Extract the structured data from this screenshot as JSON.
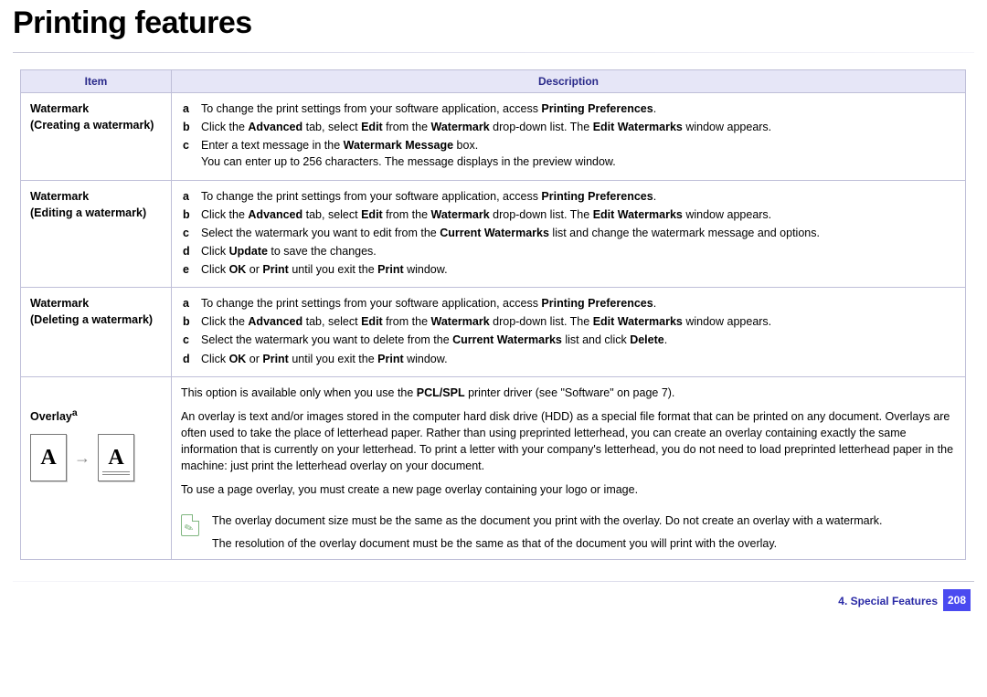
{
  "title": "Printing features",
  "table": {
    "headers": {
      "item": "Item",
      "description": "Description"
    },
    "rows": {
      "r1": {
        "item_head": "Watermark",
        "item_sub": "(Creating a watermark)",
        "a": {
          "pre": "To change the print settings from your software application, access ",
          "b1": "Printing Preferences",
          "post": "."
        },
        "b": {
          "t1": "Click the ",
          "b1": "Advanced",
          "t2": " tab, select ",
          "b2": "Edit",
          "t3": " from the ",
          "b3": "Watermark",
          "t4": " drop-down list. The ",
          "b4": "Edit Watermarks",
          "t5": " window appears."
        },
        "c": {
          "t1": "Enter a text message in the ",
          "b1": "Watermark Message",
          "t2": " box."
        },
        "c_note": "You can enter up to 256 characters. The message displays in the preview window."
      },
      "r2": {
        "item_head": "Watermark",
        "item_sub": "(Editing a watermark)",
        "a": {
          "pre": "To change the print settings from your software application, access ",
          "b1": "Printing Preferences",
          "post": "."
        },
        "b": {
          "t1": "Click the ",
          "b1": "Advanced",
          "t2": " tab, select ",
          "b2": "Edit",
          "t3": " from the ",
          "b3": "Watermark",
          "t4": " drop-down list. The ",
          "b4": "Edit Watermarks",
          "t5": " window appears."
        },
        "c": {
          "t1": "Select the watermark you want to edit from the ",
          "b1": "Current Watermarks",
          "t2": " list and change the watermark message and options."
        },
        "d": {
          "t1": "Click ",
          "b1": "Update",
          "t2": " to save the changes."
        },
        "e": {
          "t1": "Click ",
          "b1": "OK",
          "t2": " or ",
          "b2": "Print",
          "t3": " until you exit the ",
          "b3": "Print",
          "t4": " window."
        }
      },
      "r3": {
        "item_head": "Watermark",
        "item_sub": "(Deleting a watermark)",
        "a": {
          "pre": "To change the print settings from your software application, access ",
          "b1": "Printing Preferences",
          "post": "."
        },
        "b": {
          "t1": "Click the ",
          "b1": "Advanced",
          "t2": " tab, select ",
          "b2": "Edit",
          "t3": " from the ",
          "b3": "Watermark",
          "t4": " drop-down list. The ",
          "b4": "Edit Watermarks",
          "t5": " window appears."
        },
        "c": {
          "t1": "Select the watermark you want to delete from the ",
          "b1": "Current Watermarks",
          "t2": " list and click ",
          "b2": "Delete",
          "t3": "."
        },
        "d": {
          "t1": "Click ",
          "b1": "OK",
          "t2": " or ",
          "b2": "Print",
          "t3": " until you exit the ",
          "b3": "Print",
          "t4": " window."
        }
      },
      "r4": {
        "item_head_html": "Overlay",
        "item_sup": "a",
        "p1": {
          "t1": "This option is available only when you use the ",
          "b1": "PCL/SPL",
          "t2": " printer driver (see \"Software\" on page 7)."
        },
        "p2": "An overlay is text and/or images stored in the computer hard disk drive (HDD) as a special file format that can be printed on any document. Overlays are often used to take the place of letterhead paper. Rather than using preprinted letterhead, you can create an overlay containing exactly the same information that is currently on your letterhead. To print a letter with your company's letterhead, you do not need to load preprinted letterhead paper in the machine: just print the letterhead overlay on your document.",
        "p3": "To use a page overlay, you must create a new page overlay containing your logo or image.",
        "note1": "The overlay document size must be the same as the document you print with the overlay. Do not create an overlay with a watermark.",
        "note2": "The resolution of the overlay document must be the same as that of the document you will print with the overlay."
      }
    }
  },
  "footer": {
    "chapter": "4.  Special Features",
    "page": "208"
  },
  "illus": {
    "letter": "A"
  },
  "labels": {
    "a": "a",
    "b": "b",
    "c": "c",
    "d": "d",
    "e": "e"
  }
}
